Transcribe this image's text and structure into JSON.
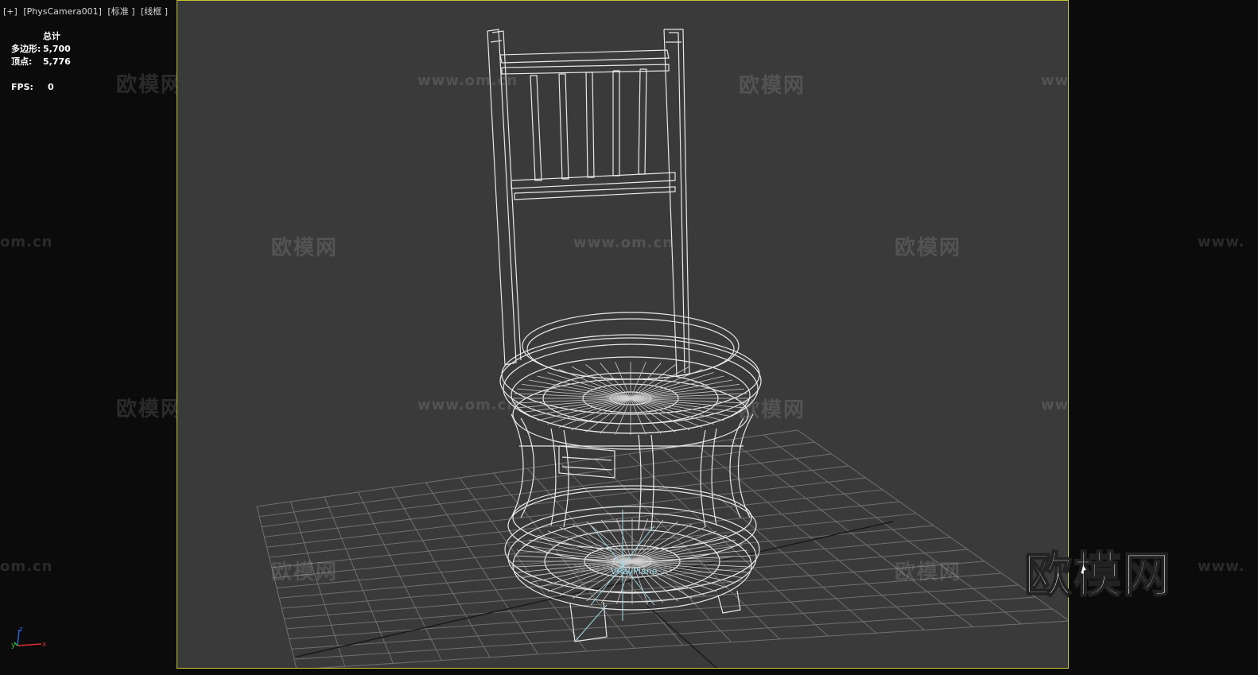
{
  "viewport": {
    "labels": [
      "[+]",
      "[PhysCamera001]",
      "[标准 ]",
      "[线框 ]"
    ]
  },
  "stats": {
    "header": "总计",
    "polygons_label": "多边形:",
    "polygons_value": "5,700",
    "vertices_label": "顶点:",
    "vertices_value": "5,776",
    "fps_label": "FPS:",
    "fps_value": "0"
  },
  "object_label": "VRayPlane",
  "watermarks": {
    "brand": "欧模网",
    "url": "www.om.cn",
    "url_partial": "om.cn",
    "url_prefix": "www."
  },
  "gizmo": {
    "x": "x",
    "y": "y",
    "z": "z"
  },
  "colors": {
    "safe_frame": "#c8c832",
    "viewport_bg": "#3a3a3a",
    "wire": "#e6e6e6",
    "grid": "#6e6e6e",
    "vrayplane": "#9fd9e8"
  }
}
